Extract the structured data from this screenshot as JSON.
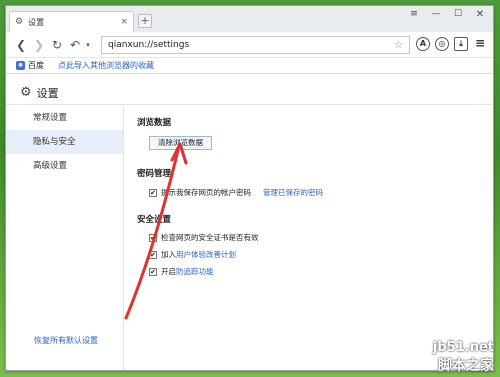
{
  "tab": {
    "title": "设置"
  },
  "toolbar": {
    "url": "qianxun://settings"
  },
  "bookmarks": {
    "baidu": "百度",
    "import_link": "点此导入其他浏览器的收藏"
  },
  "page": {
    "title": "设置"
  },
  "sidebar": {
    "items": [
      {
        "label": "常规设置"
      },
      {
        "label": "隐私与安全"
      },
      {
        "label": "高级设置"
      }
    ],
    "restore": "恢复所有默认设置"
  },
  "browsing": {
    "title": "浏览数据",
    "clear_button": "清除浏览数据"
  },
  "password": {
    "title": "密码管理",
    "save_prompt": "提示我保存网页的帐户密码",
    "manage_link": "管理已保存的密码",
    "save_prompt_checked": true
  },
  "security": {
    "title": "安全设置",
    "items": [
      {
        "pre": "检查网页的安全证书是否有效",
        "link": "",
        "checked": true
      },
      {
        "pre": "加入",
        "link": "用户体验改善计划",
        "checked": true
      },
      {
        "pre": "开启",
        "link": "防追踪功能",
        "checked": true
      }
    ]
  },
  "watermark": {
    "line1": "jb51.net",
    "line2": "脚本之家"
  },
  "colors": {
    "accent": "#2a64c8",
    "arrow": "#e03030"
  }
}
